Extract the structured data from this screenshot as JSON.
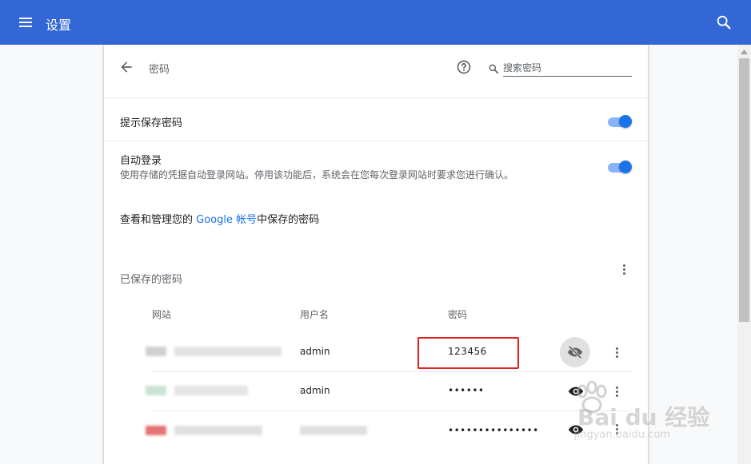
{
  "header": {
    "title": "设置",
    "menu_icon": "menu-icon",
    "search_icon": "search-icon",
    "background": "#3367d6"
  },
  "page": {
    "title": "密码",
    "back_icon": "arrow-back-icon",
    "help_icon": "help-icon",
    "search_placeholder": "搜索密码"
  },
  "settings": {
    "offer_to_save": {
      "label": "提示保存密码",
      "enabled": true
    },
    "auto_signin": {
      "label": "自动登录",
      "description": "使用存储的凭据自动登录网站。停用该功能后，系统会在您每次登录网站时要求您进行确认。",
      "enabled": true
    },
    "google_account": {
      "prefix": "查看和管理您的 ",
      "link": "Google 帐号",
      "suffix": "中保存的密码"
    }
  },
  "saved_passwords": {
    "section_title": "已保存的密码",
    "columns": [
      "网站",
      "用户名",
      "密码"
    ],
    "rows": [
      {
        "site": "",
        "username": "admin",
        "password": "123456",
        "shown": true
      },
      {
        "site": "",
        "username": "admin",
        "password": "••••••",
        "shown": false
      },
      {
        "site": "",
        "username": "",
        "password": "•••••••••••••••",
        "shown": false
      }
    ]
  },
  "watermark": {
    "text": "Bai du 经验",
    "url": "jingyan.baidu.com"
  },
  "colors": {
    "accent": "#1a73e8",
    "toggle_track": "#8ab4f8",
    "highlight": "#e02020"
  }
}
